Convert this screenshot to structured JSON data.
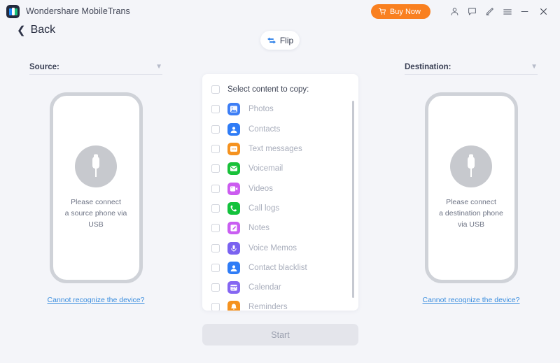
{
  "window": {
    "app_title": "Wondershare MobileTrans",
    "logo_icon": "app-logo-icon",
    "buy_now_label": "Buy Now",
    "buy_now_color": "#f98020",
    "controls": [
      {
        "name": "account-icon",
        "glyph": "person"
      },
      {
        "name": "feedback-icon",
        "glyph": "chat"
      },
      {
        "name": "edit-icon",
        "glyph": "pencil"
      },
      {
        "name": "menu-icon",
        "glyph": "hamburger"
      },
      {
        "name": "minimize-icon",
        "glyph": "minus"
      },
      {
        "name": "close-icon",
        "glyph": "cross"
      }
    ]
  },
  "nav": {
    "back_label": "Back",
    "back_icon": "chevron-left-icon"
  },
  "flip": {
    "label": "Flip",
    "icon": "flip-arrows-icon",
    "icon_color": "#2b7fe8"
  },
  "source": {
    "label": "Source:",
    "dropdown_icon": "chevron-down-icon",
    "phone_message_line1": "Please connect",
    "phone_message_line2": "a source phone via",
    "phone_message_line3": "USB",
    "usb_icon": "usb-connector-icon",
    "help_link": "Cannot recognize the device?",
    "help_link_color": "#3a8dde"
  },
  "destination": {
    "label": "Destination:",
    "dropdown_icon": "chevron-down-icon",
    "phone_message_line1": "Please connect",
    "phone_message_line2": "a destination phone",
    "phone_message_line3": "via USB",
    "usb_icon": "usb-connector-icon",
    "help_link": "Cannot recognize the device?",
    "help_link_color": "#3a8dde"
  },
  "content_panel": {
    "header_label": "Select content to copy:",
    "header_checked": false,
    "items": [
      {
        "label": "Photos",
        "icon": "photos-icon",
        "color": "#3d7ef5",
        "checked": false
      },
      {
        "label": "Contacts",
        "icon": "contacts-icon",
        "color": "#2f7cf6",
        "checked": false
      },
      {
        "label": "Text messages",
        "icon": "text-messages-icon",
        "color": "#f5921f",
        "checked": false
      },
      {
        "label": "Voicemail",
        "icon": "voicemail-icon",
        "color": "#19c139",
        "checked": false
      },
      {
        "label": "Videos",
        "icon": "videos-icon",
        "color": "#cc5bf0",
        "checked": false
      },
      {
        "label": "Call logs",
        "icon": "call-logs-icon",
        "color": "#13c23c",
        "checked": false
      },
      {
        "label": "Notes",
        "icon": "notes-icon",
        "color": "#c95ef2",
        "checked": false
      },
      {
        "label": "Voice Memos",
        "icon": "voice-memos-icon",
        "color": "#7a62f0",
        "checked": false
      },
      {
        "label": "Contact blacklist",
        "icon": "contact-blacklist-icon",
        "color": "#2f7cf6",
        "checked": false
      },
      {
        "label": "Calendar",
        "icon": "calendar-icon",
        "color": "#8566f2",
        "checked": false
      },
      {
        "label": "Reminders",
        "icon": "reminders-icon",
        "color": "#f5921f",
        "checked": false
      }
    ],
    "scrollbar_visible": true
  },
  "action": {
    "start_label": "Start",
    "start_enabled": false
  }
}
